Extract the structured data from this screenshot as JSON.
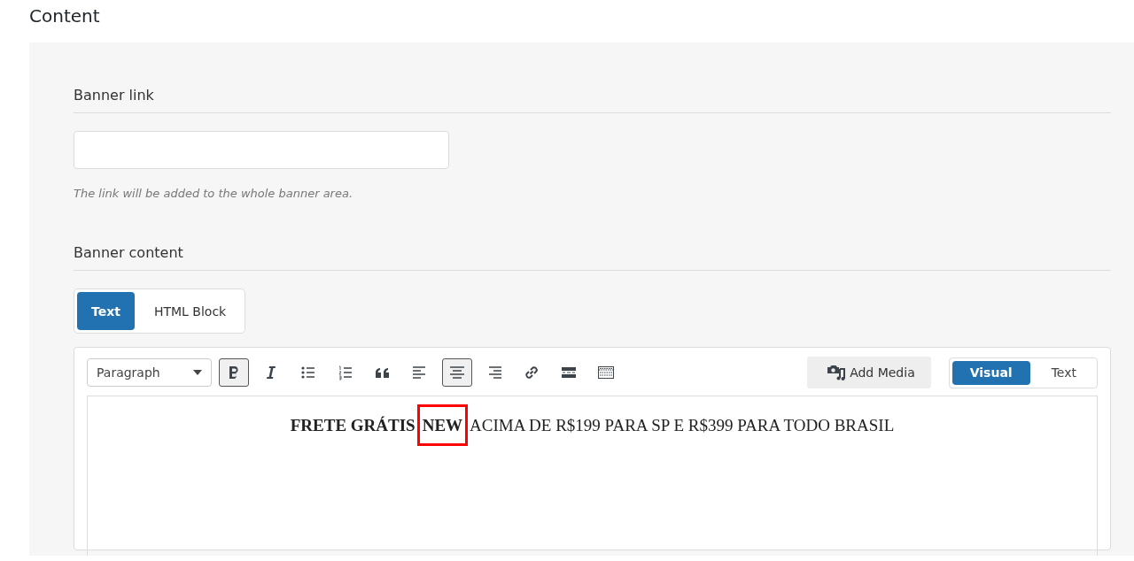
{
  "page_title": "Content",
  "banner_link": {
    "label": "Banner link",
    "help": "The link will be added to the whole banner area."
  },
  "banner_content": {
    "label": "Banner content",
    "mode_tabs": [
      {
        "label": "Text",
        "selected": true
      },
      {
        "label": "HTML Block",
        "selected": false
      }
    ],
    "editor": {
      "format": "Paragraph",
      "tools": [
        {
          "kind": "bold",
          "active": true
        },
        {
          "kind": "italic",
          "active": false
        },
        {
          "kind": "bullets",
          "active": false
        },
        {
          "kind": "numbers",
          "active": false
        },
        {
          "kind": "quote",
          "active": false
        },
        {
          "kind": "align-left",
          "active": false
        },
        {
          "kind": "align-center",
          "active": true
        },
        {
          "kind": "align-right",
          "active": false
        },
        {
          "kind": "link",
          "active": false
        },
        {
          "kind": "more",
          "active": false
        },
        {
          "kind": "toolbar",
          "active": false
        }
      ],
      "add_media": "Add Media",
      "view_tabs": [
        {
          "label": "Visual",
          "selected": true
        },
        {
          "label": "Text",
          "selected": false
        }
      ],
      "content": [
        {
          "text": "FRETE GRÁTIS",
          "bold": true,
          "highlighted": false
        },
        {
          "text": "NEW",
          "bold": true,
          "highlighted": true
        },
        {
          "text": "ACIMA DE R$199 PARA SP E R$399 PARA TODO BRASIL",
          "bold": false,
          "highlighted": false
        }
      ]
    }
  }
}
